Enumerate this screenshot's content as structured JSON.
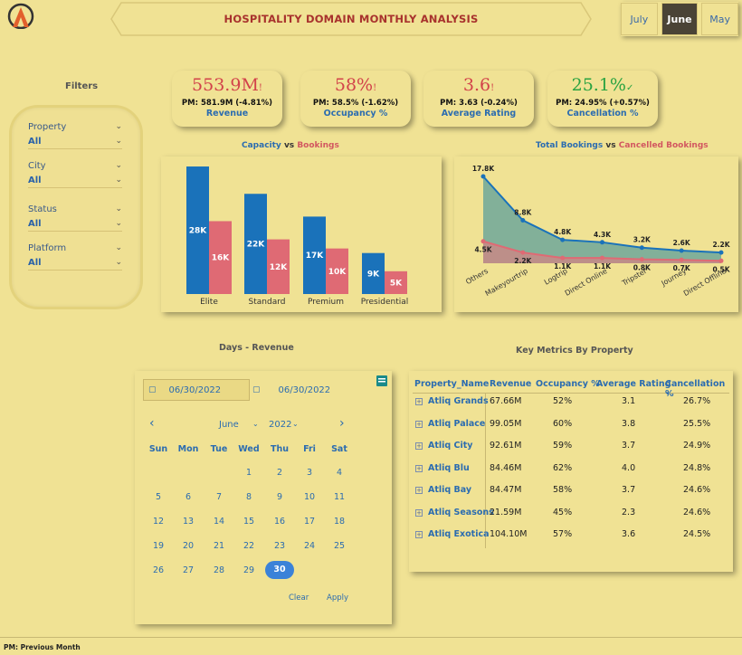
{
  "header": {
    "title": "HOSPITALITY DOMAIN MONTHLY ANALYSIS"
  },
  "months": [
    {
      "label": "July",
      "active": false
    },
    {
      "label": "June",
      "active": true
    },
    {
      "label": "May",
      "active": false
    }
  ],
  "filters": {
    "title": "Filters",
    "items": [
      {
        "label": "Property",
        "value": "All"
      },
      {
        "label": "City",
        "value": "All"
      },
      {
        "label": "Status",
        "value": "All"
      },
      {
        "label": "Platform",
        "value": "All"
      }
    ]
  },
  "kpis": [
    {
      "value": "553.9M",
      "indicator": "!",
      "sub": "PM: 581.9M (-4.81%)",
      "label": "Revenue",
      "color": "#d2424a"
    },
    {
      "value": "58%",
      "indicator": "!",
      "sub": "PM: 58.5% (-1.62%)",
      "label": "Occupancy %",
      "color": "#d2424a"
    },
    {
      "value": "3.6",
      "indicator": "!",
      "sub": "PM: 3.63 (-0.24%)",
      "label": "Average Rating",
      "color": "#d2424a"
    },
    {
      "value": "25.1%",
      "indicator": "✓",
      "sub": "PM: 24.95% (+0.57%)",
      "label": "Cancellation %",
      "color": "#2aa341"
    }
  ],
  "capacity_chart": {
    "title_a": "Capacity",
    "title_vs": "vs",
    "title_b": "Bookings"
  },
  "bookings_chart": {
    "title_a": "Total Bookings",
    "title_vs": "vs",
    "title_b": "Cancelled Bookings"
  },
  "chart_data": [
    {
      "type": "bar",
      "categories": [
        "Elite",
        "Standard",
        "Premium",
        "Presidential"
      ],
      "series": [
        {
          "name": "Capacity",
          "values": [
            28,
            22,
            17,
            9
          ],
          "labels": [
            "28K",
            "22K",
            "17K",
            "9K"
          ],
          "color": "#1a72ba"
        },
        {
          "name": "Bookings",
          "values": [
            16,
            12,
            10,
            5
          ],
          "labels": [
            "16K",
            "12K",
            "10K",
            "5K"
          ],
          "color": "#df6a74"
        }
      ]
    },
    {
      "type": "area",
      "categories": [
        "Others",
        "Makeyourtrip",
        "Logtrip",
        "Direct Online",
        "Tripster",
        "Journey",
        "Direct Offline"
      ],
      "series": [
        {
          "name": "Total Bookings",
          "values": [
            17.8,
            8.8,
            4.8,
            4.3,
            3.2,
            2.6,
            2.2
          ],
          "labels": [
            "17.8K",
            "8.8K",
            "4.8K",
            "4.3K",
            "3.2K",
            "2.6K",
            "2.2K"
          ],
          "color": "#1a72ba"
        },
        {
          "name": "Cancelled Bookings",
          "values": [
            4.5,
            2.2,
            1.1,
            1.1,
            0.8,
            0.7,
            0.5
          ],
          "labels": [
            "4.5K",
            "2.2K",
            "1.1K",
            "1.1K",
            "0.8K",
            "0.7K",
            "0.5K"
          ],
          "color": "#df6a74"
        }
      ]
    }
  ],
  "days_revenue": {
    "title": "Days - Revenue",
    "start_date": "06/30/2022",
    "end_date": "06/30/2022",
    "month": "June",
    "year": "2022",
    "days_of_week": [
      "Sun",
      "Mon",
      "Tue",
      "Wed",
      "Thu",
      "Fri",
      "Sat"
    ],
    "weeks": [
      [
        "",
        "",
        "",
        "1",
        "2",
        "3",
        "4"
      ],
      [
        "5",
        "6",
        "7",
        "8",
        "9",
        "10",
        "11"
      ],
      [
        "12",
        "13",
        "14",
        "15",
        "16",
        "17",
        "18"
      ],
      [
        "19",
        "20",
        "21",
        "22",
        "23",
        "24",
        "25"
      ],
      [
        "26",
        "27",
        "28",
        "29",
        "30",
        "",
        ""
      ]
    ],
    "selected_day": "30",
    "clear_label": "Clear",
    "apply_label": "Apply"
  },
  "metrics_table": {
    "title": "Key Metrics By Property",
    "columns": [
      "Property_Name",
      "Revenue",
      "Occupancy %",
      "Average Rating",
      "Cancellation %"
    ],
    "rows": [
      [
        "Atliq Grands",
        "67.66M",
        "52%",
        "3.1",
        "26.7%"
      ],
      [
        "Atliq Palace",
        "99.05M",
        "60%",
        "3.8",
        "25.5%"
      ],
      [
        "Atliq City",
        "92.61M",
        "59%",
        "3.7",
        "24.9%"
      ],
      [
        "Atliq Blu",
        "84.46M",
        "62%",
        "4.0",
        "24.8%"
      ],
      [
        "Atliq Bay",
        "84.47M",
        "58%",
        "3.7",
        "24.6%"
      ],
      [
        "Atliq Seasons",
        "21.59M",
        "45%",
        "2.3",
        "24.6%"
      ],
      [
        "Atliq Exotica",
        "104.10M",
        "57%",
        "3.6",
        "24.5%"
      ]
    ]
  },
  "footer": {
    "note": "PM: Previous Month"
  }
}
